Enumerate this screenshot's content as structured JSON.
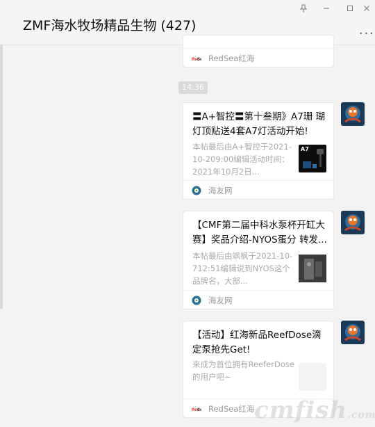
{
  "window": {
    "title": "ZMF海水牧场精品生物 (427)",
    "pin_icon": "pin-icon",
    "min_icon": "minimize-icon",
    "max_icon": "maximize-icon",
    "close_icon": "close-icon",
    "more_label": "..."
  },
  "time_separator": "14:36",
  "top_card": {
    "source": "RedSea红海",
    "source_logo_text": "RedSea"
  },
  "messages": [
    {
      "title": "〓A+智控〓第十叁期》A7珊 瑚灯顶贴送4套A7灯活动开始!",
      "desc": "本帖最后由A+智控于2021-10-209:00编辑活动时间：2021年10月2日...",
      "thumb_label": "A7",
      "source": "海友网"
    },
    {
      "title": "【CMF第二届中科水泵杯开缸大赛】奖品介绍-NYOS蛋分 转发...",
      "desc": "本帖最后由飒枫于2021-10-712:51编辑说到NYOS这个品牌名，大部...",
      "source": "海友网"
    },
    {
      "title": "【活动】红海新品ReefDose滴定泵抢先Get!",
      "desc": "来成为首位拥有ReeferDose的用户吧~",
      "source": "RedSea红海",
      "source_logo_text": "RedSea"
    }
  ],
  "watermark": {
    "main": "cmfish",
    "suffix": ".com"
  },
  "colors": {
    "background": "#f3f3f3",
    "card": "#ffffff",
    "muted_text": "#aaaaaa",
    "redsea": "#d6262b",
    "haiyou": "#2a6f8f"
  }
}
